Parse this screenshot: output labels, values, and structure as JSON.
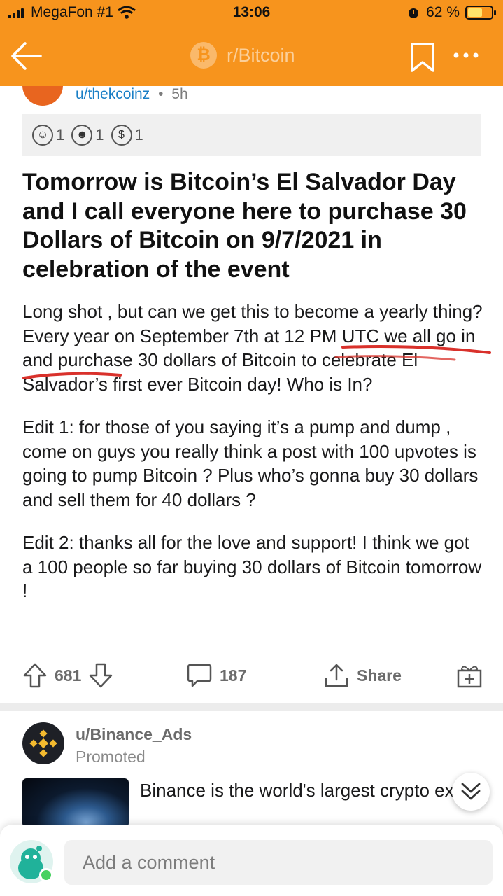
{
  "status_bar": {
    "carrier": "MegaFon #1",
    "time": "13:06",
    "battery": "62 %",
    "battery_level": 0.62
  },
  "nav": {
    "subreddit": "r/Bitcoin",
    "btc_symbol": "₿",
    "back_icon": "back-arrow-icon",
    "bookmark_icon": "bookmark-icon",
    "more_icon": "more-icon"
  },
  "post": {
    "author": "u/thekcoinz",
    "age": "5h",
    "separator": "•",
    "awards": [
      {
        "icon": "award-icon",
        "count": "1"
      },
      {
        "icon": "award-icon",
        "count": "1"
      },
      {
        "icon": "award-icon",
        "count": "1"
      }
    ],
    "title": "Tomorrow is Bitcoin’s El Salvador Day and I call everyone here to purchase 30 Dollars of Bitcoin on 9/7/2021 in celebration of the event",
    "paragraphs": [
      "Long shot , but can we get this to become a yearly thing? Every year on September 7th at 12 PM UTC we all go in and purchase 30 dollars of Bitcoin to celebrate El Salvador’s first ever Bitcoin day! Who is In?",
      "Edit 1: for those of you saying it’s a pump and dump , come on guys you really think a post with 100 upvotes is going to pump Bitcoin ? Plus who’s gonna buy 30 dollars and sell them for 40 dollars ?",
      "Edit 2: thanks all for the love and support! I think we got a 100 people so far buying 30 dollars of Bitcoin tomorrow !"
    ]
  },
  "actions": {
    "score": "681",
    "comments": "187",
    "share": "Share"
  },
  "promoted": {
    "user": "u/Binance_Ads",
    "label": "Promoted",
    "text": "Binance is the world's largest crypto exchange. That means better price"
  },
  "comment_bar": {
    "placeholder": "Add a comment"
  },
  "colors": {
    "header": "#f7941d",
    "link": "#1a7fc6",
    "annotation": "#d9312b"
  }
}
